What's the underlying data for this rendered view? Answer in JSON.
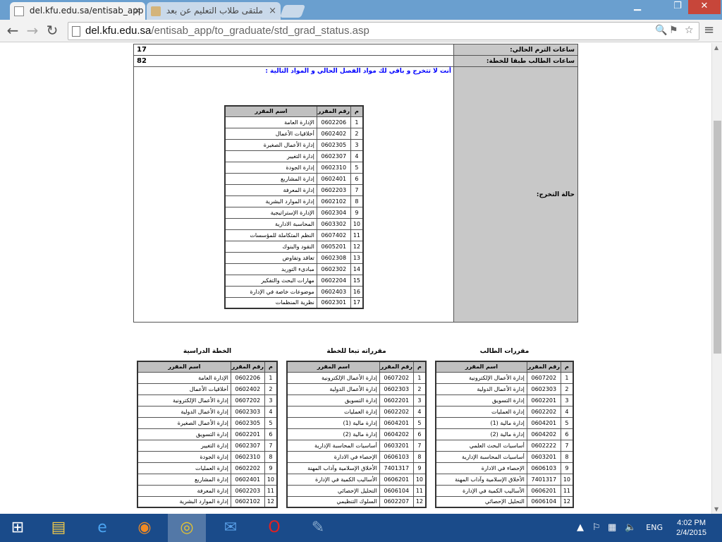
{
  "browser": {
    "tabs": [
      {
        "title": "del.kfu.edu.sa/entisab_app",
        "close": "×"
      },
      {
        "title": "ملتقى طلاب التعليم عن بعد",
        "close": "×"
      }
    ],
    "url_domain": "del.kfu.edu.sa",
    "url_path": "/entisab_app/to_graduate/std_grad_status.asp",
    "window_buttons": [
      "▁",
      "❐",
      "✕"
    ]
  },
  "info": {
    "current_hours_label": "ساعات الترم الحالي:",
    "current_hours_value": "17",
    "plan_hours_label": "ساعات الطالب طبقا للخطة:",
    "plan_hours_value": "82",
    "grad_status_label": "حالة التخرج:",
    "notice": "أنت لا تتخرج و باقي لك مواد الفصل الحالي و المواد التالية :"
  },
  "headers": {
    "num": "م",
    "code": "رقم المقرر",
    "name": "اسم المقرر"
  },
  "remaining": [
    [
      "1",
      "0602206",
      "الإدارة العامة"
    ],
    [
      "2",
      "0602402",
      "أخلاقيات الأعمال"
    ],
    [
      "3",
      "0602305",
      "إدارة الأعمال الصغيرة"
    ],
    [
      "4",
      "0602307",
      "إدارة التغيير"
    ],
    [
      "5",
      "0602310",
      "إدارة الجودة"
    ],
    [
      "6",
      "0602401",
      "إدارة المشاريع"
    ],
    [
      "7",
      "0602203",
      "إدارة المعرفة"
    ],
    [
      "8",
      "0602102",
      "إدارة الموارد البشرية"
    ],
    [
      "9",
      "0602304",
      "الإدارة الإستراتيجية"
    ],
    [
      "10",
      "0603302",
      "المحاسبة الادارية"
    ],
    [
      "11",
      "0607402",
      "النظم المتكاملة للمؤسسات"
    ],
    [
      "12",
      "0605201",
      "النقود والبنوك"
    ],
    [
      "13",
      "0602308",
      "تعاقد وتفاوض"
    ],
    [
      "14",
      "0602302",
      "مبادىء التوريد"
    ],
    [
      "15",
      "0602204",
      "مهارات البحث والتفكير"
    ],
    [
      "16",
      "0602403",
      "موضوعات خاصة في الإدارة"
    ],
    [
      "17",
      "0602301",
      "نظرية المنظمات"
    ]
  ],
  "captions": {
    "student": "مقررات الطالب",
    "equiv": "مقرراته تبعا للخطة",
    "plan": "الخطة الدراسية"
  },
  "student_courses": [
    [
      "1",
      "0607202",
      "إدارة الأعمال الإلكترونية"
    ],
    [
      "2",
      "0602303",
      "إدارة الأعمال الدولية"
    ],
    [
      "3",
      "0602201",
      "إدارة التسويق"
    ],
    [
      "4",
      "0602202",
      "إدارة العمليات"
    ],
    [
      "5",
      "0604201",
      "إدارة مالية (1)"
    ],
    [
      "6",
      "0604202",
      "إدارة مالية (2)"
    ],
    [
      "7",
      "0602222",
      "أساسيات البحث العلمي"
    ],
    [
      "8",
      "0603201",
      "أساسيات المحاسبة الإدارية"
    ],
    [
      "9",
      "0606103",
      "الإحصاء في الادارة"
    ],
    [
      "10",
      "7401317",
      "الأخلاق الإسلامية وآداب المهنة"
    ],
    [
      "11",
      "0606201",
      "الأساليب الكمية في الإدارة"
    ],
    [
      "12",
      "0606104",
      "التحليل الإحصائي"
    ]
  ],
  "equiv_courses": [
    [
      "1",
      "0607202",
      "إدارة الأعمال الإلكترونية"
    ],
    [
      "2",
      "0602303",
      "إدارة الأعمال الدولية"
    ],
    [
      "3",
      "0602201",
      "إدارة التسويق"
    ],
    [
      "4",
      "0602202",
      "إدارة العمليات"
    ],
    [
      "5",
      "0604201",
      "إدارة مالية (1)"
    ],
    [
      "6",
      "0604202",
      "إدارة مالية (2)"
    ],
    [
      "7",
      "0603201",
      "أساسيات المحاسبة الإدارية"
    ],
    [
      "8",
      "0606103",
      "الإحصاء في الادارة"
    ],
    [
      "9",
      "7401317",
      "الأخلاق الإسلامية وآداب المهنة"
    ],
    [
      "10",
      "0606201",
      "الأساليب الكمية في الإدارة"
    ],
    [
      "11",
      "0606104",
      "التحليل الإحصائي"
    ],
    [
      "12",
      "0602207",
      "السلوك التنظيمي"
    ]
  ],
  "plan_courses": [
    [
      "1",
      "0602206",
      "الإدارة العامة"
    ],
    [
      "2",
      "0602402",
      "أخلاقيات الأعمال"
    ],
    [
      "3",
      "0607202",
      "إدارة الأعمال الإلكترونية"
    ],
    [
      "4",
      "0602303",
      "إدارة الأعمال الدولية"
    ],
    [
      "5",
      "0602305",
      "إدارة الأعمال الصغيرة"
    ],
    [
      "6",
      "0602201",
      "إدارة التسويق"
    ],
    [
      "7",
      "0602307",
      "إدارة التغيير"
    ],
    [
      "8",
      "0602310",
      "إدارة الجودة"
    ],
    [
      "9",
      "0602202",
      "إدارة العمليات"
    ],
    [
      "10",
      "0602401",
      "إدارة المشاريع"
    ],
    [
      "11",
      "0602203",
      "إدارة المعرفة"
    ],
    [
      "12",
      "0602102",
      "إدارة الموارد البشرية"
    ]
  ],
  "taskbar": {
    "lang": "ENG",
    "time": "4:02 PM",
    "date": "2/4/2015"
  }
}
